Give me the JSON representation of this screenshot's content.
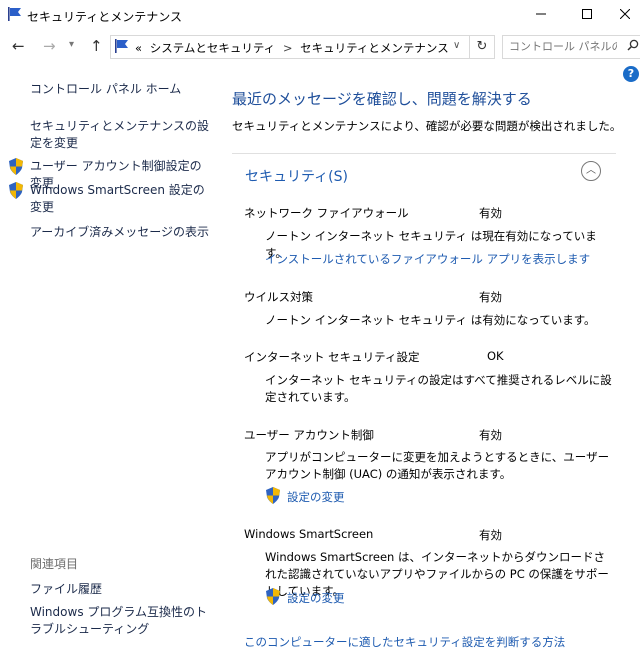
{
  "window": {
    "title": "セキュリティとメンテナンス",
    "min_icon": "minimize-icon",
    "max_icon": "maximize-icon",
    "close_icon": "close-icon"
  },
  "address": {
    "prefix": "«",
    "crumbs": [
      "システムとセキュリティ",
      "セキュリティとメンテナンス"
    ],
    "separator": ">",
    "search_placeholder": "コントロール パネルの検..."
  },
  "help_label": "?",
  "left": {
    "home": "コントロール パネル ホーム",
    "links": [
      "セキュリティとメンテナンスの設定を変更",
      "ユーザー アカウント制御設定の変更",
      "Windows SmartScreen 設定の変更",
      "アーカイブ済みメッセージの表示"
    ],
    "related_title": "関連項目",
    "related": [
      "ファイル履歴",
      "Windows プログラム互換性のトラブルシューティング"
    ]
  },
  "main": {
    "heading": "最近のメッセージを確認し、問題を解決する",
    "subheading": "セキュリティとメンテナンスにより、確認が必要な問題が検出されました。",
    "section_title": "セキュリティ(S)",
    "rows": [
      {
        "name": "ネットワーク ファイアウォール",
        "status": "有効",
        "desc": "ノートン インターネット セキュリティ は現在有効になっています。",
        "link": "インストールされているファイアウォール アプリを表示します"
      },
      {
        "name": "ウイルス対策",
        "status": "有効",
        "desc": "ノートン インターネット セキュリティ は有効になっています。"
      },
      {
        "name": "インターネット セキュリティ設定",
        "status": "OK",
        "desc": "インターネット セキュリティの設定はすべて推奨されるレベルに設定されています。"
      },
      {
        "name": "ユーザー アカウント制御",
        "status": "有効",
        "desc": "アプリがコンピューターに変更を加えようとするときに、ユーザー アカウント制御 (UAC) の通知が表示されます。",
        "link": "設定の変更"
      },
      {
        "name": "Windows SmartScreen",
        "status": "有効",
        "desc": "Windows SmartScreen は、インターネットからダウンロードされた認識されていないアプリやファイルからの PC の保護をサポートしています。",
        "link": "設定の変更"
      }
    ],
    "footer_link": "このコンピューターに適したセキュリティ設定を判断する方法"
  }
}
